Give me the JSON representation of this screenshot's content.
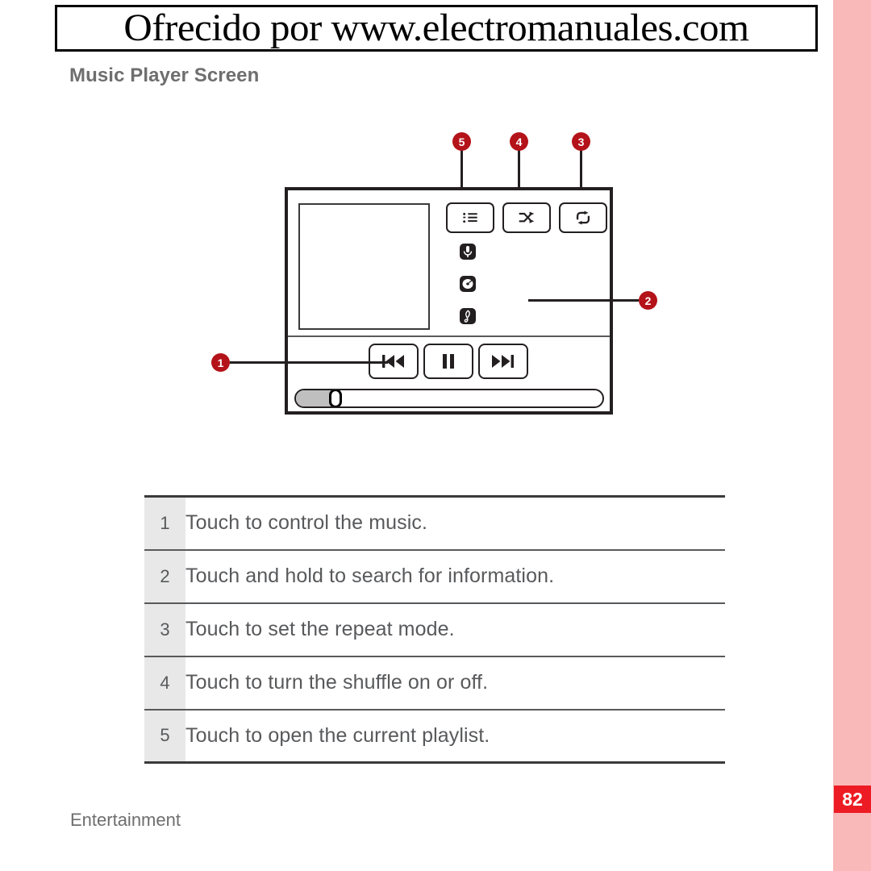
{
  "watermark": {
    "text": "Ofrecido por www.electromanuales.com"
  },
  "heading": "Music Player Screen",
  "figure": {
    "device": {
      "album_art_label": "album-art-placeholder",
      "mode_buttons": [
        {
          "id": "playlist",
          "icon": "playlist-icon",
          "callout": "5"
        },
        {
          "id": "shuffle",
          "icon": "shuffle-icon",
          "callout": "4"
        },
        {
          "id": "repeat",
          "icon": "repeat-icon",
          "callout": "3"
        }
      ],
      "meta_icons": [
        {
          "id": "artist",
          "icon": "microphone-icon"
        },
        {
          "id": "album",
          "icon": "disc-icon"
        },
        {
          "id": "song",
          "icon": "music-note-icon"
        }
      ],
      "transport_buttons": [
        {
          "id": "previous",
          "icon": "previous-track-icon"
        },
        {
          "id": "pause",
          "icon": "pause-icon"
        },
        {
          "id": "next",
          "icon": "next-track-icon"
        }
      ],
      "progress": {
        "percent": 13,
        "fill_color": "#bfbfbf"
      }
    },
    "callouts": [
      {
        "number": "1",
        "target": "transport-controls"
      },
      {
        "number": "2",
        "target": "track-information-area"
      },
      {
        "number": "3",
        "target": "repeat-button"
      },
      {
        "number": "4",
        "target": "shuffle-button"
      },
      {
        "number": "5",
        "target": "playlist-button"
      }
    ]
  },
  "table": {
    "rows": [
      {
        "num": "1",
        "text": "Touch to control the music."
      },
      {
        "num": "2",
        "text": "Touch and hold to search for information."
      },
      {
        "num": "3",
        "text": "Touch to set the repeat mode."
      },
      {
        "num": "4",
        "text": "Touch to turn the shuffle on or off."
      },
      {
        "num": "5",
        "text": "Touch to open the current playlist."
      }
    ]
  },
  "footer": {
    "label": "Entertainment",
    "page_number": "82"
  },
  "colors": {
    "callout_red": "#b31319",
    "page_badge_red": "#ed1c24",
    "edge_strip_pink": "#f9b9b9",
    "text_gray": "#58595b",
    "number_cell_gray": "#e8e8e8"
  }
}
